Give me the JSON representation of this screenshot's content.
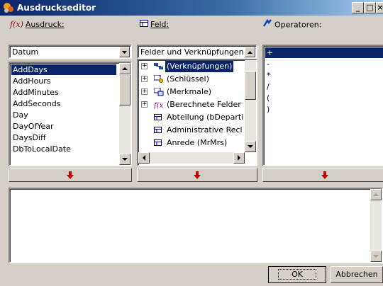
{
  "window": {
    "title": "Ausdruckseditor"
  },
  "labels": {
    "expression": "Ausdruck:",
    "field": "Feld:",
    "operators": "Operatoren:"
  },
  "function_combo": {
    "value": "Datum"
  },
  "functions": [
    "AddDays",
    "AddHours",
    "AddMinutes",
    "AddSeconds",
    "Day",
    "DayOfYear",
    "DaysDiff",
    "DbToLocalDate"
  ],
  "field_combo": {
    "value": "Felder und Verknüpfungen"
  },
  "fields": [
    {
      "label": "(Verknüpfungen)",
      "icon": "links-icon",
      "expandable": true,
      "selected": true
    },
    {
      "label": "(Schlüssel)",
      "icon": "key-icon",
      "expandable": true,
      "selected": false
    },
    {
      "label": "(Merkmale)",
      "icon": "features-icon",
      "expandable": true,
      "selected": false
    },
    {
      "label": "(Berechnete Felder",
      "icon": "function-icon",
      "expandable": true,
      "selected": false
    },
    {
      "label": "Abteilung (bDeparti",
      "icon": "field-icon",
      "expandable": false,
      "selected": false
    },
    {
      "label": "Administrative Recl",
      "icon": "field-icon",
      "expandable": false,
      "selected": false
    },
    {
      "label": "Anrede (MrMrs)",
      "icon": "field-icon",
      "expandable": false,
      "selected": false
    }
  ],
  "operators": [
    "+",
    "-",
    "*",
    "/",
    "(",
    ")"
  ],
  "expression_text": "",
  "buttons": {
    "ok": "OK",
    "cancel": "Abbrechen"
  }
}
